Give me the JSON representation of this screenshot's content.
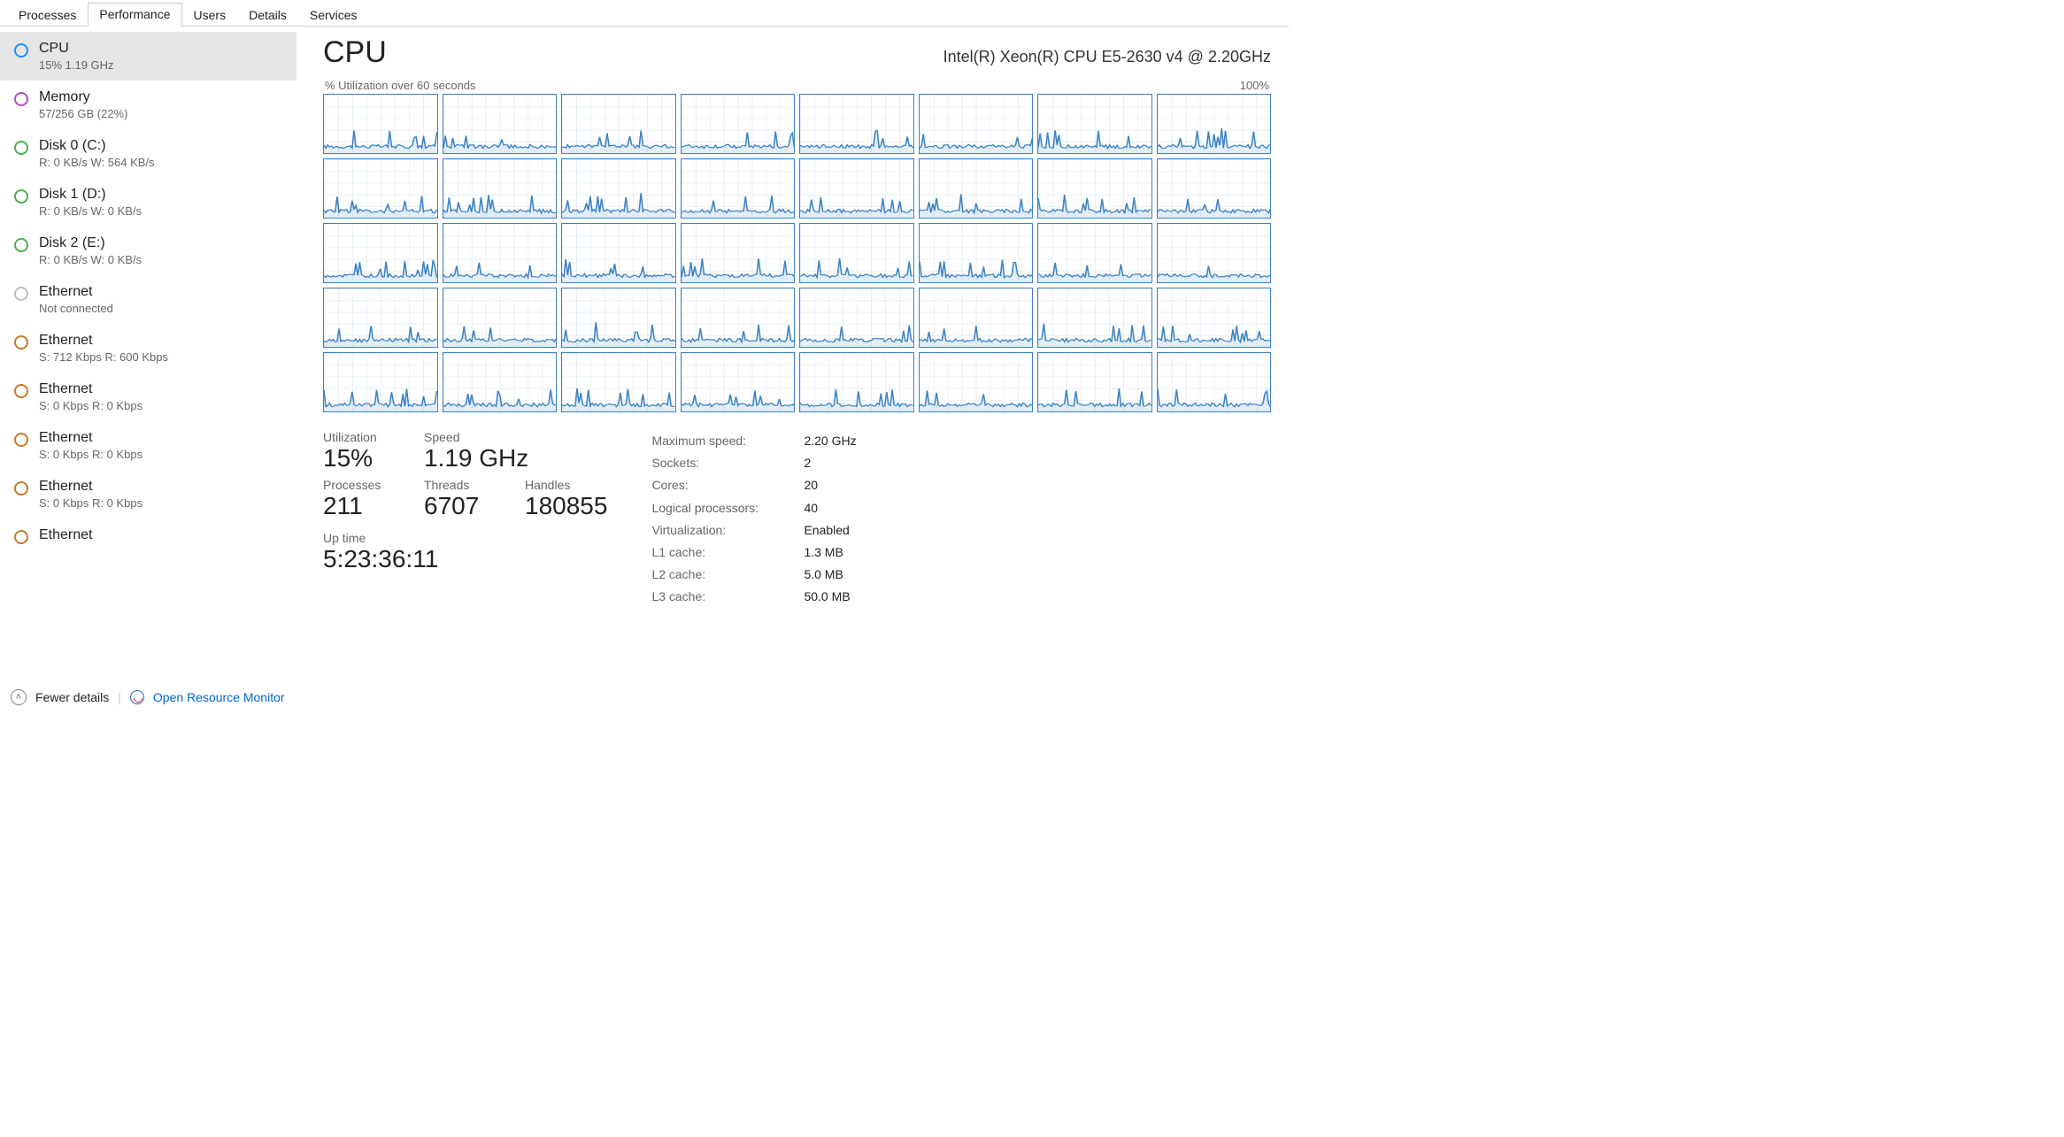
{
  "tabs": [
    "Processes",
    "Performance",
    "Users",
    "Details",
    "Services"
  ],
  "activeTab": 1,
  "sidebar": [
    {
      "title": "CPU",
      "sub": "15%  1.19 GHz",
      "iconColor": "blue",
      "selected": true
    },
    {
      "title": "Memory",
      "sub": "57/256 GB (22%)",
      "iconColor": "purple",
      "selected": false
    },
    {
      "title": "Disk 0 (C:)",
      "sub": "R: 0 KB/s W: 564 KB/s",
      "iconColor": "green",
      "selected": false
    },
    {
      "title": "Disk 1 (D:)",
      "sub": "R: 0 KB/s W: 0 KB/s",
      "iconColor": "green",
      "selected": false
    },
    {
      "title": "Disk 2 (E:)",
      "sub": "R: 0 KB/s W: 0 KB/s",
      "iconColor": "green",
      "selected": false
    },
    {
      "title": "Ethernet",
      "sub": "Not connected",
      "iconColor": "grey",
      "selected": false
    },
    {
      "title": "Ethernet",
      "sub": "S: 712 Kbps R: 600 Kbps",
      "iconColor": "orange",
      "selected": false
    },
    {
      "title": "Ethernet",
      "sub": "S: 0 Kbps R: 0 Kbps",
      "iconColor": "orange",
      "selected": false
    },
    {
      "title": "Ethernet",
      "sub": "S: 0 Kbps R: 0 Kbps",
      "iconColor": "orange",
      "selected": false
    },
    {
      "title": "Ethernet",
      "sub": "S: 0 Kbps R: 0 Kbps",
      "iconColor": "orange",
      "selected": false
    },
    {
      "title": "Ethernet",
      "sub": "",
      "iconColor": "orange",
      "selected": false
    }
  ],
  "main": {
    "title": "CPU",
    "model": "Intel(R) Xeon(R) CPU E5-2630 v4 @ 2.20GHz",
    "axisLabelLeft": "% Utilization over 60 seconds",
    "axisLabelRight": "100%",
    "stats": {
      "utilization": {
        "label": "Utilization",
        "value": "15%"
      },
      "speed": {
        "label": "Speed",
        "value": "1.19 GHz"
      },
      "processes": {
        "label": "Processes",
        "value": "211"
      },
      "threads": {
        "label": "Threads",
        "value": "6707"
      },
      "handles": {
        "label": "Handles",
        "value": "180855"
      },
      "uptime": {
        "label": "Up time",
        "value": "5:23:36:11"
      }
    },
    "specs": [
      {
        "key": "Maximum speed:",
        "val": "2.20 GHz"
      },
      {
        "key": "Sockets:",
        "val": "2"
      },
      {
        "key": "Cores:",
        "val": "20"
      },
      {
        "key": "Logical processors:",
        "val": "40"
      },
      {
        "key": "Virtualization:",
        "val": "Enabled"
      },
      {
        "key": "L1 cache:",
        "val": "1.3 MB"
      },
      {
        "key": "L2 cache:",
        "val": "5.0 MB"
      },
      {
        "key": "L3 cache:",
        "val": "50.0 MB"
      }
    ]
  },
  "footer": {
    "fewer": "Fewer details",
    "openRM": "Open Resource Monitor"
  },
  "chart_data": {
    "type": "line",
    "title": "% Utilization over 60 seconds",
    "ylim": [
      0,
      100
    ],
    "xrange_seconds": 60,
    "num_cores": 40,
    "note": "Per-logical-processor utilization; values estimated from mini-chart heights (~0-30% with occasional spikes)."
  }
}
